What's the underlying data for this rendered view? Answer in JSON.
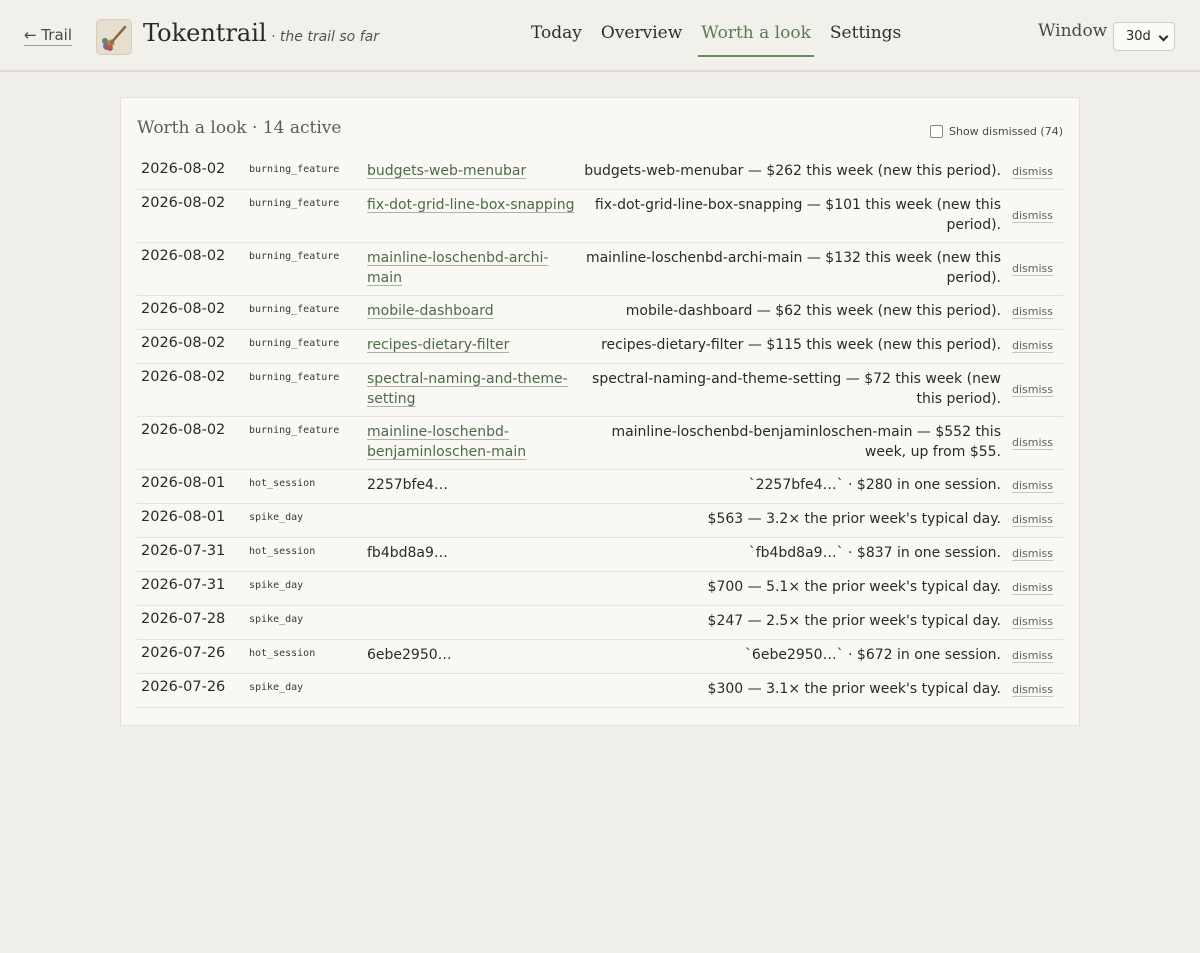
{
  "header": {
    "back_label": "← Trail",
    "brand": "Tokentrail",
    "tagline": "· the trail so far",
    "nav": [
      {
        "label": "Today",
        "active": false
      },
      {
        "label": "Overview",
        "active": false
      },
      {
        "label": "Worth a look",
        "active": true
      },
      {
        "label": "Settings",
        "active": false
      }
    ],
    "window_label": "Window",
    "window_value": "30d"
  },
  "panel": {
    "title": "Worth a look · 14 active",
    "show_dismissed_label": "Show dismissed (74)",
    "rows": [
      {
        "date": "2026-08-02",
        "kind": "burning_feature",
        "subject": "budgets-web-menubar",
        "subject_is_link": true,
        "desc": "budgets-web-menubar — $262 this week (new this period).",
        "action": "dismiss",
        "height": 34,
        "lines": 1
      },
      {
        "date": "2026-08-02",
        "kind": "burning_feature",
        "subject": "fix-dot-grid-line-box-snapping",
        "subject_is_link": true,
        "desc": "fix-dot-grid-line-box-snapping — $101 this week (new this period).",
        "action": "dismiss",
        "height": 53,
        "lines": 2
      },
      {
        "date": "2026-08-02",
        "kind": "burning_feature",
        "subject": "mainline-loschenbd-archi-main",
        "subject_is_link": true,
        "desc": "mainline-loschenbd-archi-main — $132 this week (new this period).",
        "action": "dismiss",
        "height": 53,
        "lines": 2
      },
      {
        "date": "2026-08-02",
        "kind": "burning_feature",
        "subject": "mobile-dashboard",
        "subject_is_link": true,
        "desc": "mobile-dashboard — $62 this week (new this period).",
        "action": "dismiss",
        "height": 34,
        "lines": 1
      },
      {
        "date": "2026-08-02",
        "kind": "burning_feature",
        "subject": "recipes-dietary-filter",
        "subject_is_link": true,
        "desc": "recipes-dietary-filter — $115 this week (new this period).",
        "action": "dismiss",
        "height": 34,
        "lines": 1
      },
      {
        "date": "2026-08-02",
        "kind": "burning_feature",
        "subject": "spectral-naming-and-theme-setting",
        "subject_is_link": true,
        "desc": "spectral-naming-and-theme-setting — $72 this week (new this period).",
        "action": "dismiss",
        "height": 53,
        "lines": 2
      },
      {
        "date": "2026-08-02",
        "kind": "burning_feature",
        "subject": "mainline-loschenbd-benjaminloschen-main",
        "subject_is_link": true,
        "desc": "mainline-loschenbd-benjaminloschen-main — $552 this week, up from $55.",
        "action": "dismiss",
        "height": 53,
        "lines": 2
      },
      {
        "date": "2026-08-01",
        "kind": "hot_session",
        "subject": "2257bfe4…",
        "subject_is_link": false,
        "desc": "`2257bfe4…` · $280 in one session.",
        "action": "dismiss",
        "height": 34,
        "lines": 1
      },
      {
        "date": "2026-08-01",
        "kind": "spike_day",
        "subject": "",
        "subject_is_link": false,
        "desc": "$563 — 3.2× the prior week's typical day.",
        "action": "dismiss",
        "height": 34,
        "lines": 1
      },
      {
        "date": "2026-07-31",
        "kind": "hot_session",
        "subject": "fb4bd8a9…",
        "subject_is_link": false,
        "desc": "`fb4bd8a9…` · $837 in one session.",
        "action": "dismiss",
        "height": 34,
        "lines": 1
      },
      {
        "date": "2026-07-31",
        "kind": "spike_day",
        "subject": "",
        "subject_is_link": false,
        "desc": "$700 — 5.1× the prior week's typical day.",
        "action": "dismiss",
        "height": 34,
        "lines": 1
      },
      {
        "date": "2026-07-28",
        "kind": "spike_day",
        "subject": "",
        "subject_is_link": false,
        "desc": "$247 — 2.5× the prior week's typical day.",
        "action": "dismiss",
        "height": 34,
        "lines": 1
      },
      {
        "date": "2026-07-26",
        "kind": "hot_session",
        "subject": "6ebe2950…",
        "subject_is_link": false,
        "desc": "`6ebe2950…` · $672 in one session.",
        "action": "dismiss",
        "height": 34,
        "lines": 1
      },
      {
        "date": "2026-07-26",
        "kind": "spike_day",
        "subject": "",
        "subject_is_link": false,
        "desc": "$300 — 3.1× the prior week's typical day.",
        "action": "dismiss",
        "height": 34,
        "lines": 1
      }
    ]
  }
}
